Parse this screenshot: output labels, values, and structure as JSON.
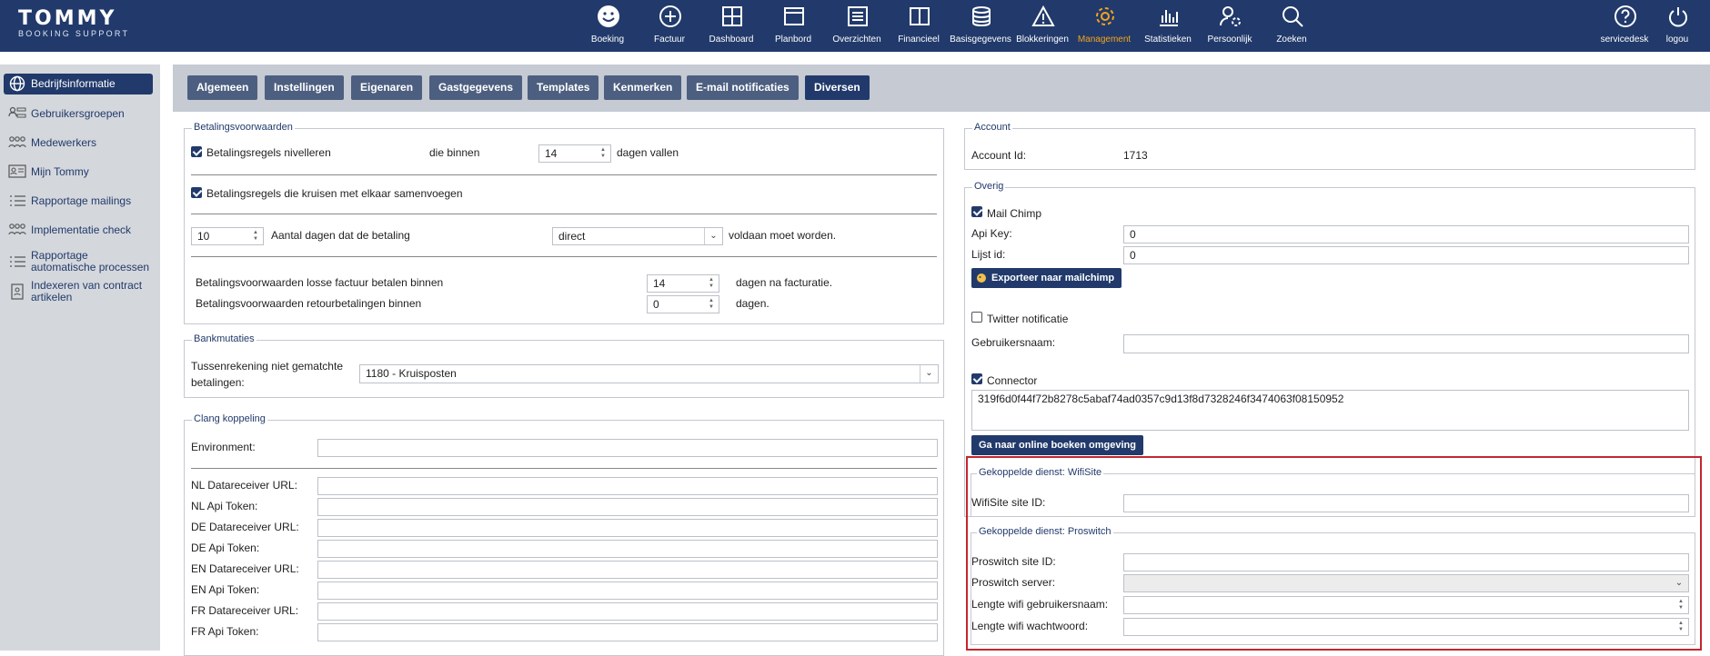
{
  "brand": {
    "name": "TOMMY",
    "tagline": "BOOKING SUPPORT"
  },
  "topnav": [
    {
      "label": "Boeking",
      "icon": "smiley-icon"
    },
    {
      "label": "Factuur",
      "icon": "plus-circle-icon"
    },
    {
      "label": "Dashboard",
      "icon": "grid-icon"
    },
    {
      "label": "Planbord",
      "icon": "window-icon"
    },
    {
      "label": "Overzichten",
      "icon": "list-icon"
    },
    {
      "label": "Financieel",
      "icon": "book-icon"
    },
    {
      "label": "Basisgegevens",
      "icon": "database-icon"
    },
    {
      "label": "Blokkeringen",
      "icon": "warning-icon"
    },
    {
      "label": "Management",
      "icon": "gear-icon",
      "active": true
    },
    {
      "label": "Statistieken",
      "icon": "bar-chart-icon"
    },
    {
      "label": "Persoonlijk",
      "icon": "user-gear-icon"
    },
    {
      "label": "Zoeken",
      "icon": "search-icon"
    },
    {
      "label": "servicedesk",
      "icon": "help-icon"
    },
    {
      "label": "logou",
      "icon": "power-icon"
    }
  ],
  "colors": {
    "primary": "#213a6b",
    "accent": "#f3a31c",
    "highlight": "#c4262e"
  },
  "sidebar": {
    "items": [
      {
        "label": "Bedrijfsinformatie",
        "icon": "globe-icon",
        "active": true
      },
      {
        "label": "Gebruikersgroepen",
        "icon": "user-groups-icon"
      },
      {
        "label": "Medewerkers",
        "icon": "team-icon"
      },
      {
        "label": "Mijn Tommy",
        "icon": "id-card-icon"
      },
      {
        "label": "Rapportage mailings",
        "icon": "list-icon"
      },
      {
        "label": "Implementatie check",
        "icon": "team-icon"
      },
      {
        "label": "Rapportage automatische processen",
        "icon": "list-icon"
      },
      {
        "label": "Indexeren van contract artikelen",
        "icon": "document-user-icon"
      }
    ]
  },
  "tabs": [
    {
      "label": "Algemeen"
    },
    {
      "label": "Instellingen"
    },
    {
      "label": "Eigenaren"
    },
    {
      "label": "Gastgegevens"
    },
    {
      "label": "Templates"
    },
    {
      "label": "Kenmerken"
    },
    {
      "label": "E-mail notificaties"
    },
    {
      "label": "Diversen",
      "active": true
    }
  ],
  "betaling": {
    "legend": "Betalingsvoorwaarden",
    "nivelleren_label": "Betalingsregels nivelleren",
    "nivelleren_checked": true,
    "binnen_label": "die binnen",
    "binnen_value": "14",
    "vallen_label": "dagen vallen",
    "samenvoegen_label": "Betalingsregels die kruisen met elkaar samenvoegen",
    "samenvoegen_checked": true,
    "dagen_value": "10",
    "dagen_label": "Aantal dagen dat de betaling",
    "wanneer_value": "direct",
    "voldaan_label": "voldaan moet worden.",
    "losse_label": "Betalingsvoorwaarden losse factuur betalen binnen",
    "losse_value": "14",
    "losse_suffix": "dagen na facturatie.",
    "retour_label": "Betalingsvoorwaarden retourbetalingen binnen",
    "retour_value": "0",
    "retour_suffix": "dagen."
  },
  "bank": {
    "legend": "Bankmutaties",
    "label_line1": "Tussenrekening niet gematchte",
    "label_line2": "betalingen:",
    "value": "1180 - Kruisposten"
  },
  "clang": {
    "legend": "Clang koppeling",
    "environment_label": "Environment:",
    "environment_value": "",
    "fields": [
      {
        "label": "NL Datareceiver URL:",
        "value": ""
      },
      {
        "label": "NL Api Token:",
        "value": ""
      },
      {
        "label": "DE Datareceiver URL:",
        "value": ""
      },
      {
        "label": "DE Api Token:",
        "value": ""
      },
      {
        "label": "EN Datareceiver URL:",
        "value": ""
      },
      {
        "label": "EN Api Token:",
        "value": ""
      },
      {
        "label": "FR Datareceiver URL:",
        "value": ""
      },
      {
        "label": "FR Api Token:",
        "value": ""
      }
    ]
  },
  "account": {
    "legend": "Account",
    "id_label": "Account Id:",
    "id_value": "1713"
  },
  "overig": {
    "legend": "Overig",
    "mailchimp_label": "Mail Chimp",
    "mailchimp_checked": true,
    "apikey_label": "Api Key:",
    "apikey_value": "0",
    "lijst_label": "Lijst id:",
    "lijst_value": "0",
    "export_button": "Exporteer naar mailchimp",
    "twitter_label": "Twitter notificatie",
    "twitter_checked": false,
    "gebruikersnaam_label": "Gebruikersnaam:",
    "gebruikersnaam_value": "",
    "connector_label": "Connector",
    "connector_checked": true,
    "connector_value": "319f6d0f44f72b8278c5abaf74ad0357c9d13f8d7328246f3474063f08150952",
    "online_button": "Ga naar online boeken omgeving"
  },
  "wifisite": {
    "legend": "Gekoppelde dienst: WifiSite",
    "site_label": "WifiSite site ID:",
    "site_value": ""
  },
  "proswitch": {
    "legend": "Gekoppelde dienst: Proswitch",
    "site_label": "Proswitch site ID:",
    "site_value": "",
    "server_label": "Proswitch server:",
    "server_value": "",
    "user_len_label": "Lengte wifi gebruikersnaam:",
    "user_len_value": "",
    "pw_len_label": "Lengte wifi wachtwoord:",
    "pw_len_value": ""
  }
}
